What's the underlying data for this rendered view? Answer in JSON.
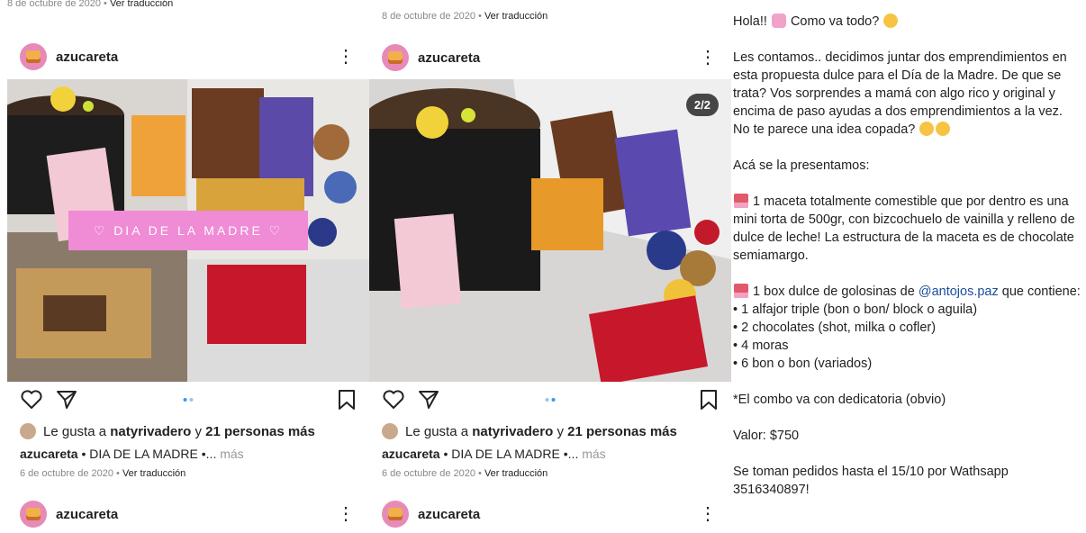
{
  "post1": {
    "top_date": "8 de octubre de 2020",
    "top_translate": "Ver traducción",
    "username": "azucareta",
    "image_label": "♡ DIA DE LA MADRE ♡",
    "likes_prefix": "Le gusta a",
    "likes_user": "natyrivadero",
    "likes_and": "y",
    "likes_count": "21 personas más",
    "caption_user": "azucareta",
    "caption_text": "• DIA DE LA MADRE •...",
    "caption_more": "más",
    "date": "6 de octubre de 2020",
    "translate": "Ver traducción",
    "next_username": "azucareta"
  },
  "post2": {
    "top_date": "8 de octubre de 2020",
    "top_translate": "Ver traducción",
    "username": "azucareta",
    "counter": "2/2",
    "likes_prefix": "Le gusta a",
    "likes_user": "natyrivadero",
    "likes_and": "y",
    "likes_count": "21 personas más",
    "caption_user": "azucareta",
    "caption_text": "• DIA DE LA MADRE •...",
    "caption_more": "más",
    "date": "6 de octubre de 2020",
    "translate": "Ver traducción",
    "next_username": "azucareta"
  },
  "description": {
    "l1": "Hola!!",
    "l1b": "Como va todo?",
    "p2": "Les contamos.. decidimos juntar dos emprendimientos en esta propuesta dulce para el Día de la Madre. De que se trata? Vos sorprendes a mamá con algo rico y original y encima de paso ayudas a dos emprendimientos a la vez.",
    "p2b": "No te parece una idea copada?",
    "p3": "Acá se la presentamos:",
    "p4": "1 maceta totalmente comestible que por dentro es una mini torta de 500gr, con bizcochuelo de vainilla y relleno de dulce de leche! La estructura de la maceta es de chocolate semiamargo.",
    "p5a": "1 box dulce de golosinas de",
    "p5link": "@antojos.paz",
    "p5b": "que contiene:",
    "items": [
      "• 1 alfajor triple (bon o bon/ block o aguila)",
      "• 2 chocolates (shot, milka o cofler)",
      "• 4 moras",
      "• 6 bon o bon (variados)"
    ],
    "p6": "*El combo va con dedicatoria (obvio)",
    "p7": "Valor: $750",
    "p8": "Se toman pedidos hasta el 15/10 por Wathsapp 3516340897!"
  }
}
